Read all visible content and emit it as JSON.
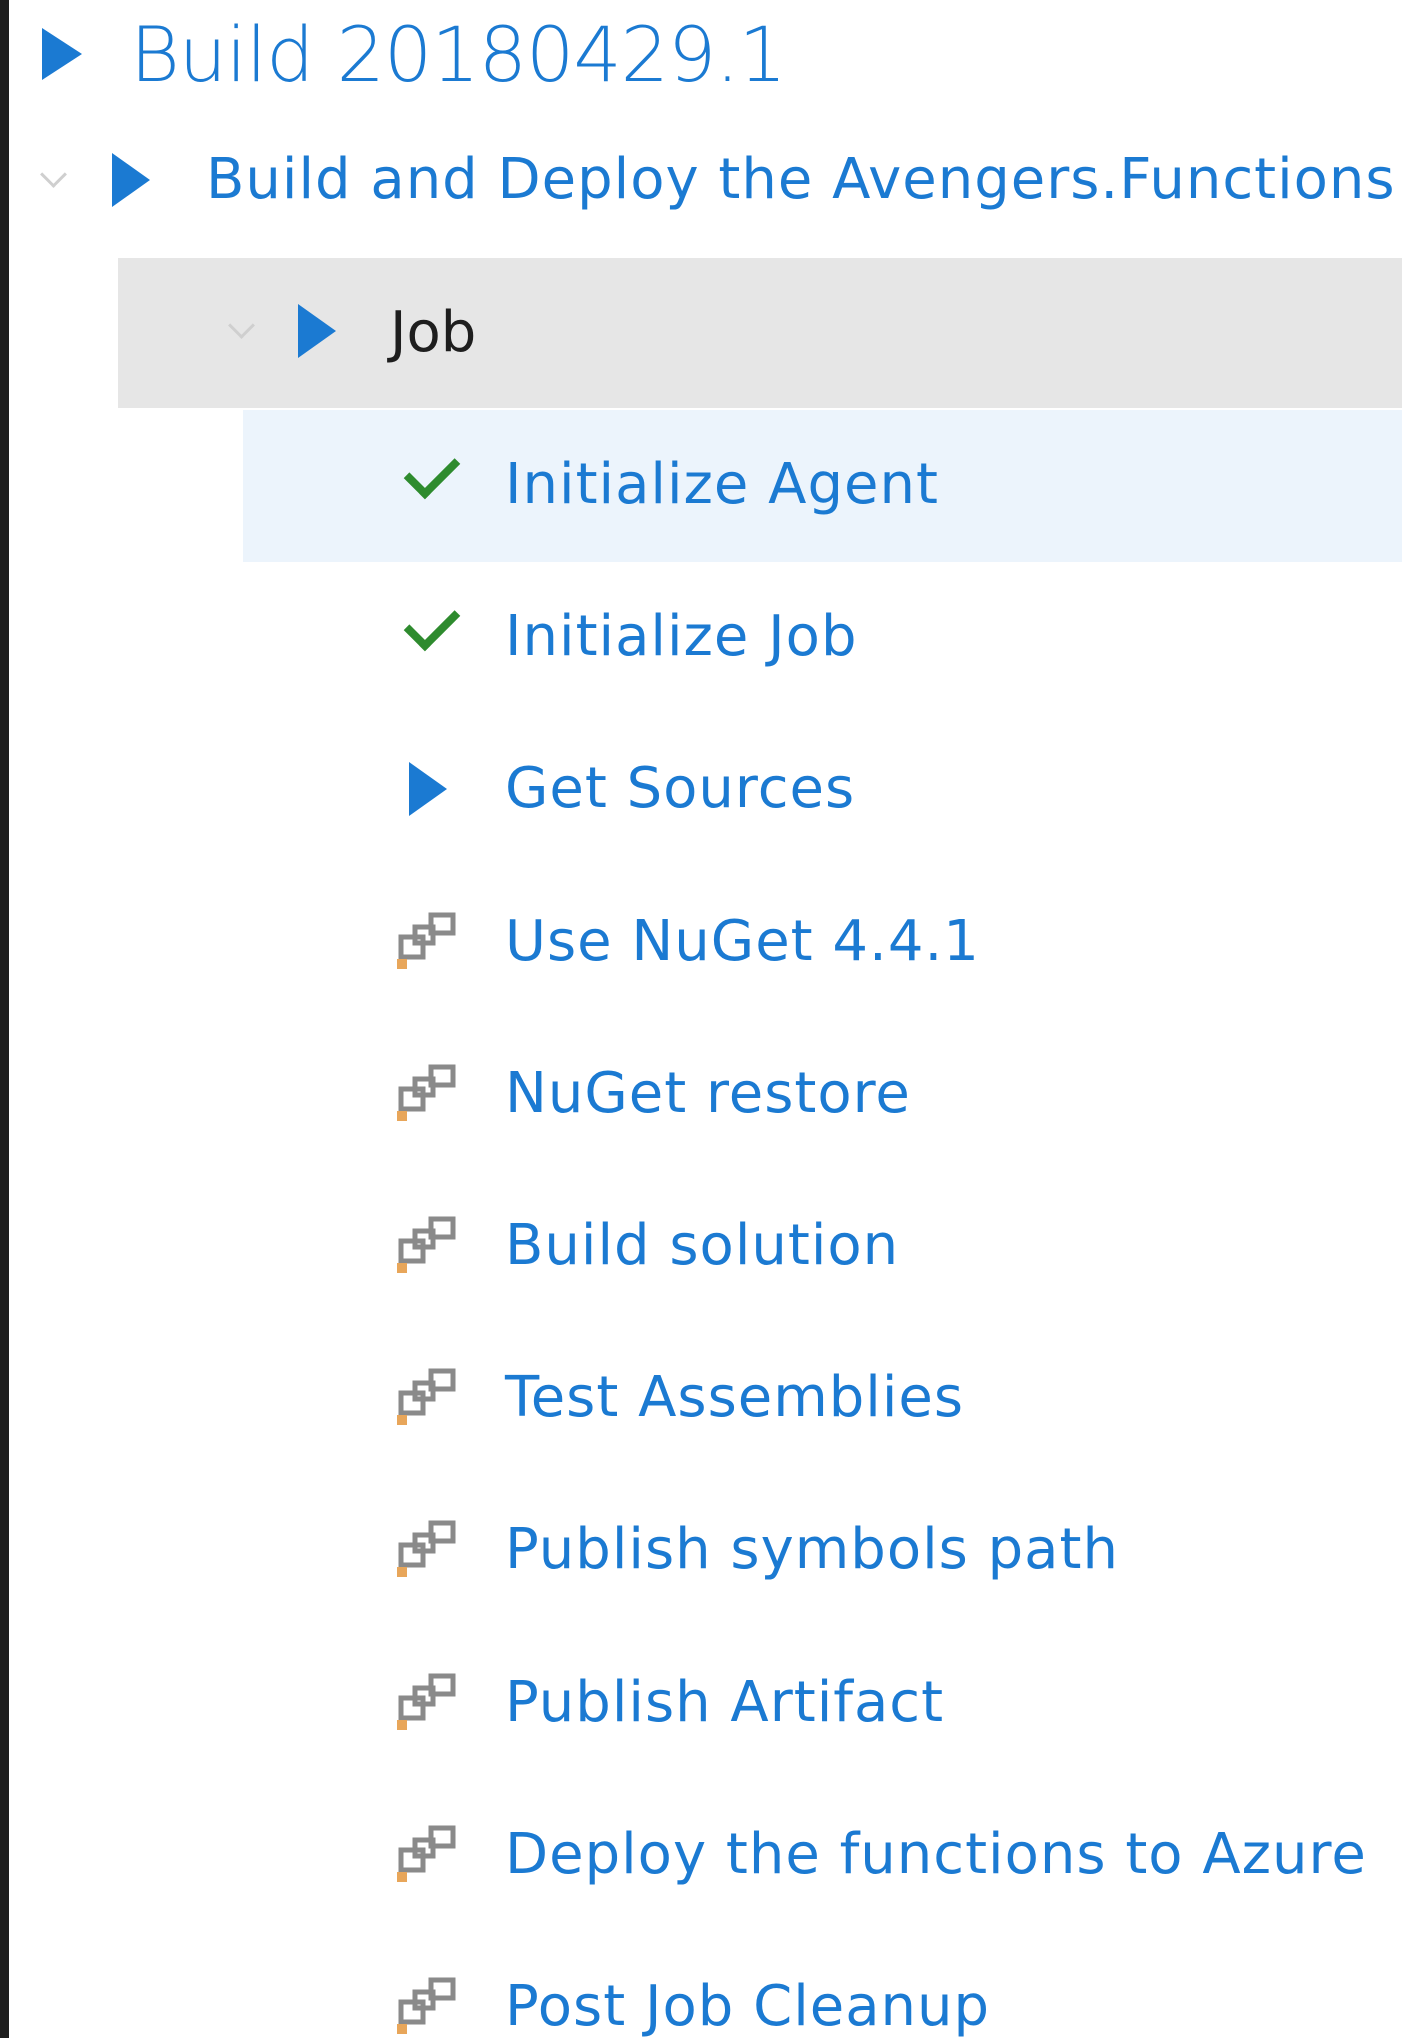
{
  "build": {
    "title": "Build 20180429.1",
    "status_icon": "running-play-icon"
  },
  "stage": {
    "label": "Build and Deploy the Avengers.Functions",
    "status_icon": "running-play-icon",
    "expand_icon": "chevron-down-icon"
  },
  "job": {
    "label": "Job",
    "status_icon": "running-play-icon",
    "expand_icon": "chevron-down-icon"
  },
  "tasks": [
    {
      "label": "Initialize Agent",
      "status": "succeeded",
      "icon": "check-icon"
    },
    {
      "label": "Initialize Job",
      "status": "succeeded",
      "icon": "check-icon"
    },
    {
      "label": "Get Sources",
      "status": "running",
      "icon": "play-icon"
    },
    {
      "label": "Use NuGet 4.4.1",
      "status": "pending",
      "icon": "task-pending-icon"
    },
    {
      "label": "NuGet restore",
      "status": "pending",
      "icon": "task-pending-icon"
    },
    {
      "label": "Build solution",
      "status": "pending",
      "icon": "task-pending-icon"
    },
    {
      "label": "Test Assemblies",
      "status": "pending",
      "icon": "task-pending-icon"
    },
    {
      "label": "Publish symbols path",
      "status": "pending",
      "icon": "task-pending-icon"
    },
    {
      "label": "Publish Artifact",
      "status": "pending",
      "icon": "task-pending-icon"
    },
    {
      "label": "Deploy the functions to Azure",
      "status": "pending",
      "icon": "task-pending-icon"
    },
    {
      "label": "Post Job Cleanup",
      "status": "pending",
      "icon": "task-pending-icon"
    }
  ],
  "colors": {
    "accent": "#1b7ad2",
    "success": "#2e8b2e",
    "selected_bg": "#ecf4fc",
    "job_bg": "#e6e6e6"
  }
}
